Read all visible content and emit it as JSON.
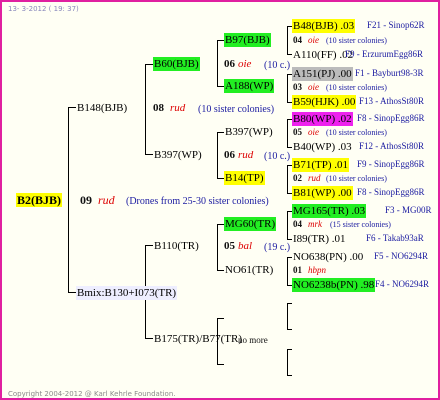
{
  "header": {
    "date": "13- 3-2012 ( 19: 37)"
  },
  "footer": {
    "copyright": "Copyright 2004-2012 @ Karl Kehrle Foundation."
  },
  "root": {
    "name": "B2(BJB)",
    "year": "09",
    "breed": "rud",
    "note": "(Drones from 25-30 sister colonies)"
  },
  "sire": {
    "name": "B148(BJB)",
    "year": "08",
    "breed": "rud",
    "note": "(10 sister colonies)"
  },
  "dam": {
    "name": "Bmix:B130+I073(TR)"
  },
  "b60": {
    "name": "B60(BJB)",
    "year": "06",
    "breed": "oie",
    "note": "(10 c.)"
  },
  "b397": {
    "name": "B397(WP)",
    "year": "06",
    "breed": "rud",
    "note": "(10 c.)"
  },
  "b110": {
    "name": "B110(TR)",
    "year": "05",
    "breed": "bal",
    "note": "(19 c.)"
  },
  "b175": {
    "name": "B175(TR)/B77(TR)",
    "more": "no more"
  },
  "b97": {
    "name": "B97(BJB)"
  },
  "a188": {
    "name": "A188(WP)"
  },
  "b397b": {
    "name": "B397(WP)"
  },
  "b14": {
    "name": "B14(TP)"
  },
  "mg60": {
    "name": "MG60(TR)"
  },
  "no61": {
    "name": "NO61(TR)"
  },
  "g4": [
    {
      "name": "B48(BJB) .03",
      "tag": "F21 - Sinop62R"
    },
    {
      "year": "04",
      "breed": "oie",
      "note": "(10 sister colonies)"
    },
    {
      "name": "A110(FF) .02",
      "tag": "F9 - ErzurumEgg86R"
    },
    {
      "name": "A151(PJ) .00",
      "tag": "F1 - Bayburt98-3R"
    },
    {
      "year": "03",
      "breed": "oie",
      "note": "(10 sister colonies)"
    },
    {
      "name": "B59(HJK) .00",
      "tag": "F13 - AthosSt80R"
    },
    {
      "name": "B80(WP) .02",
      "tag": "F8 - SinopEgg86R"
    },
    {
      "year": "05",
      "breed": "oie",
      "note": "(10 sister colonies)"
    },
    {
      "name": "B40(WP) .03",
      "tag": "F12 - AthosSt80R"
    },
    {
      "name": "B71(TP) .01",
      "tag": "F9 - SinopEgg86R"
    },
    {
      "year": "02",
      "breed": "rud",
      "note": "(10 sister colonies)"
    },
    {
      "name": "B81(WP) .00",
      "tag": "F8 - SinopEgg86R"
    },
    {
      "name": "MG165(TR) .03",
      "tag": "F3 - MG00R"
    },
    {
      "year": "04",
      "breed": "mrk",
      "note": "(15 sister colonies)"
    },
    {
      "name": "I89(TR) .01",
      "tag": "F6 - Takab93aR"
    },
    {
      "name": "NO638(PN) .00",
      "tag": "F5 - NO6294R"
    },
    {
      "year": "01",
      "breed": "hbpn",
      "note": ""
    },
    {
      "name": "NO6238b(PN) .98",
      "tag": "F4 - NO6294R"
    }
  ]
}
